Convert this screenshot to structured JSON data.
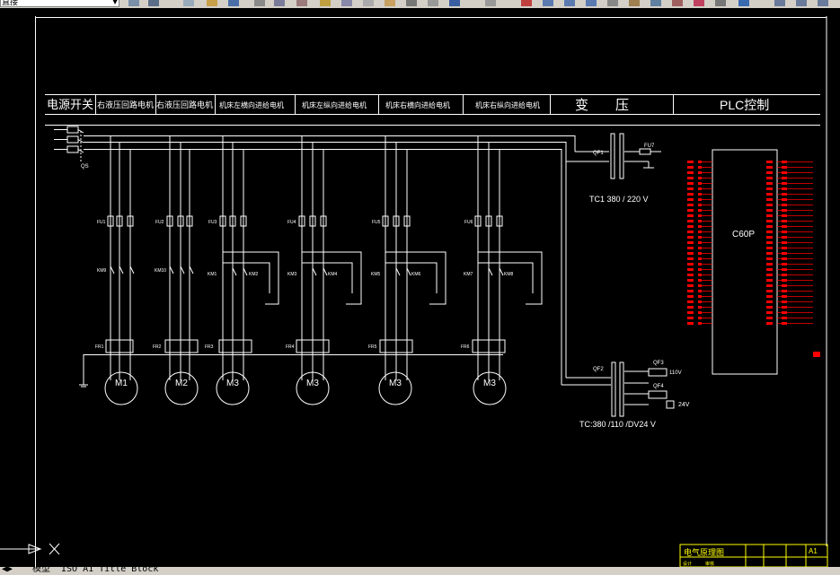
{
  "toolbar": {
    "layer_value": "直接",
    "colors": {
      "bg": "#d4d0c8"
    }
  },
  "drawing": {
    "header_cells": [
      "电源开关",
      "右液压回路电机",
      "右液压回路电机",
      "机床左横向进给电机",
      "机床左纵向进给电机",
      "机床右横向进给电机",
      "机床右纵向进给电机",
      "变　　压",
      "PLC控制"
    ],
    "switch_label": "QS",
    "fuse_labels": [
      "FU1",
      "FU2",
      "FU3",
      "FU4",
      "FU5",
      "FU6"
    ],
    "km_labels": [
      "KM9",
      "KM10",
      "KM1",
      "KM2",
      "KM3",
      "KM4",
      "KM5",
      "KM6",
      "KM7",
      "KM8"
    ],
    "fr_labels": [
      "FR1",
      "FR2",
      "FR3",
      "FR4",
      "FR5",
      "FR6"
    ],
    "motor_labels": [
      "M1",
      "M2",
      "M3",
      "M3",
      "M3",
      "M3"
    ],
    "qf_labels": [
      "QF1",
      "QF2",
      "QF3",
      "QF4"
    ],
    "fu7_label": "FU7",
    "tc1_label": "TC1 380 / 220 V",
    "tc2_label": "TC:380 /110 /DV24 V",
    "v110_label": "110V",
    "v24_label": "24V",
    "plc_label": "C60P",
    "title_block": {
      "title": "电气原理图",
      "sheet": "A1",
      "designer": "设计",
      "check": "审核"
    },
    "colors": {
      "line": "#ffffff",
      "red": "#ff0000",
      "bg": "#000000"
    }
  },
  "status": {
    "tab_model": "模型",
    "tab_layout": "ISO A1 Title Block",
    "ucs_label": "X"
  }
}
